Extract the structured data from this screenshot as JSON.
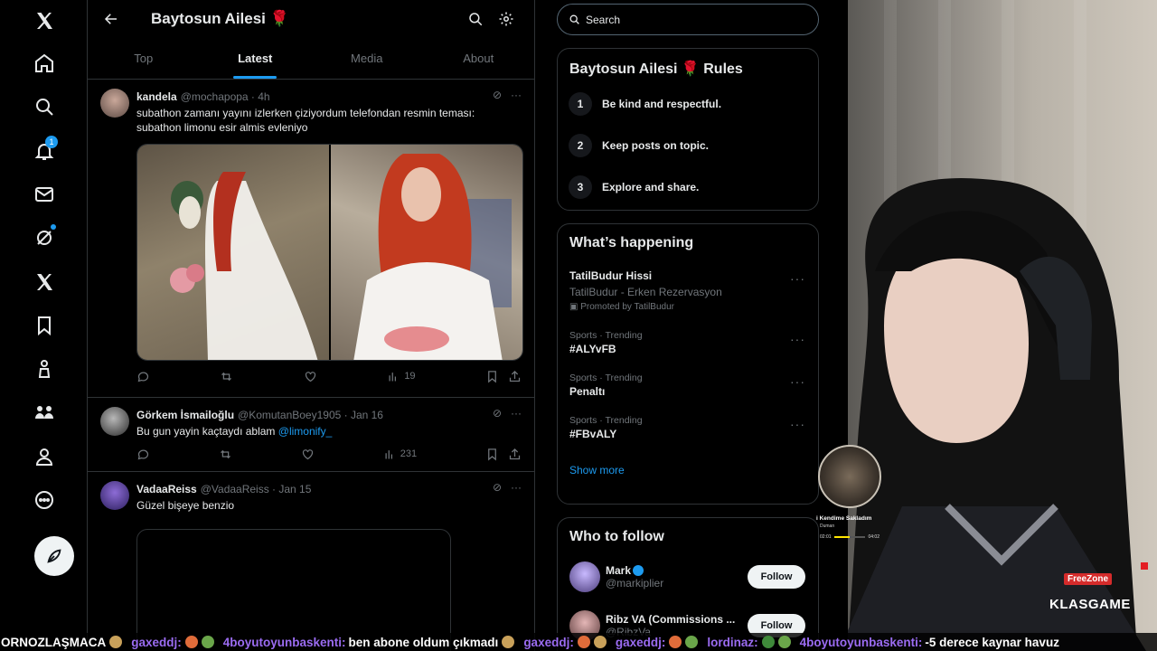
{
  "nav": {
    "badge_count": "1"
  },
  "community": {
    "title": "Baytosun Ailesi 🌹",
    "tabs": [
      {
        "label": "Top"
      },
      {
        "label": "Latest"
      },
      {
        "label": "Media"
      },
      {
        "label": "About"
      }
    ]
  },
  "tweets": [
    {
      "name": "kandela",
      "handle": "@mochapopa · 4h",
      "text": "subathon zamanı yayını izlerken çiziyordum telefondan resmin teması: subathon limonu esir almis evleniyo",
      "views": "19"
    },
    {
      "name": "Görkem İsmailoğlu",
      "handle": "@KomutanBoey1905 · Jan 16",
      "text": "Bu gun yayin kaçtaydı ablam ",
      "mention": "@limonify_",
      "views": "231"
    },
    {
      "name": "VadaaReiss",
      "handle": "@VadaaReiss · Jan 15",
      "text": "Güzel bişeye benzio"
    }
  ],
  "right": {
    "search_placeholder": "Search",
    "rules_title": "Baytosun Ailesi 🌹 Rules",
    "rules": [
      {
        "num": "1",
        "text": "Be kind and respectful."
      },
      {
        "num": "2",
        "text": "Keep posts on topic."
      },
      {
        "num": "3",
        "text": "Explore and share."
      }
    ],
    "happening_title": "What’s happening",
    "promo": {
      "topic": "TatilBudur Hissi",
      "sub": "TatilBudur - Erken Rezervasyon",
      "label": "Promoted by TatilBudur"
    },
    "trends": [
      {
        "meta": "Sports · Trending",
        "topic": "#ALYvFB"
      },
      {
        "meta": "Sports · Trending",
        "topic": "Penaltı"
      },
      {
        "meta": "Sports · Trending",
        "topic": "#FBvALY"
      }
    ],
    "show_more": "Show more",
    "follow_title": "Who to follow",
    "follow": [
      {
        "name": "Mark",
        "handle": "@markiplier",
        "button": "Follow"
      },
      {
        "name": "Ribz VA (Commissions ...",
        "handle": "@RibzVa",
        "button": "Follow"
      }
    ]
  },
  "overlay": {
    "song": "i Kendime Sakladım",
    "artist": "Duman",
    "time_start": "02:01",
    "time_end": "04:02",
    "progress": 0.5,
    "freezone": "FreeZone",
    "brand": "KLASGAME"
  },
  "ticker": {
    "items": [
      {
        "user": "",
        "msg": "ORNOZLAŞMACA"
      },
      {
        "user": "gaxeddj:",
        "msg": ""
      },
      {
        "user": "4boyutoyunbaskenti:",
        "msg": "ben abone oldum çıkmadı"
      },
      {
        "user": "gaxeddj:",
        "msg": ""
      },
      {
        "user": "gaxeddj:",
        "msg": ""
      },
      {
        "user": "lordinaz:",
        "msg": ""
      },
      {
        "user": "4boyutoyunbaskenti:",
        "msg": "-5 derece kaynar havuz"
      }
    ]
  }
}
